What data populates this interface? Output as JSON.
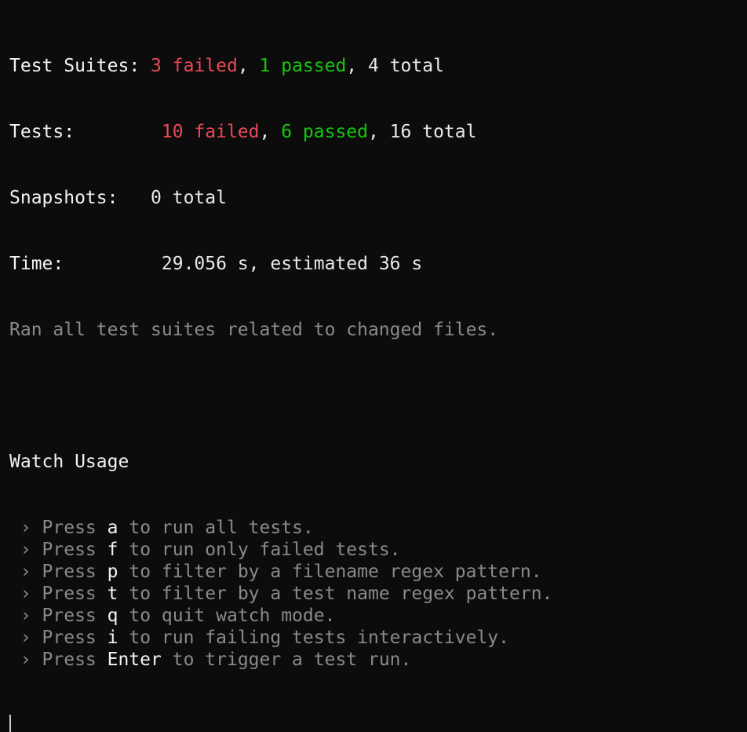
{
  "summary": {
    "suites": {
      "label": "Test Suites:",
      "failed": "3 failed",
      "sep1": ", ",
      "passed": "1 passed",
      "sep2": ", ",
      "total": "4 total"
    },
    "tests": {
      "label": "Tests:",
      "failed": "10 failed",
      "sep1": ", ",
      "passed": "6 passed",
      "sep2": ", ",
      "total": "16 total"
    },
    "snapshots": {
      "label": "Snapshots:",
      "total": "0 total"
    },
    "time": {
      "label": "Time:",
      "value": "29.056 s, estimated 36 s"
    },
    "ran_note": "Ran all test suites related to changed files."
  },
  "watch_usage": {
    "title": "Watch Usage",
    "bullet": " › ",
    "press": "Press ",
    "items": [
      {
        "key": "a",
        "desc": " to run all tests."
      },
      {
        "key": "f",
        "desc": " to run only failed tests."
      },
      {
        "key": "p",
        "desc": " to filter by a filename regex pattern."
      },
      {
        "key": "t",
        "desc": " to filter by a test name regex pattern."
      },
      {
        "key": "q",
        "desc": " to quit watch mode."
      },
      {
        "key": "i",
        "desc": " to run failing tests interactively."
      },
      {
        "key": "Enter",
        "desc": " to trigger a test run."
      }
    ]
  },
  "colors": {
    "background": "#0c0c0c",
    "failed": "#e74856",
    "passed": "#16c60c",
    "dim": "#8a8a8a",
    "text": "#e8e8e8"
  }
}
